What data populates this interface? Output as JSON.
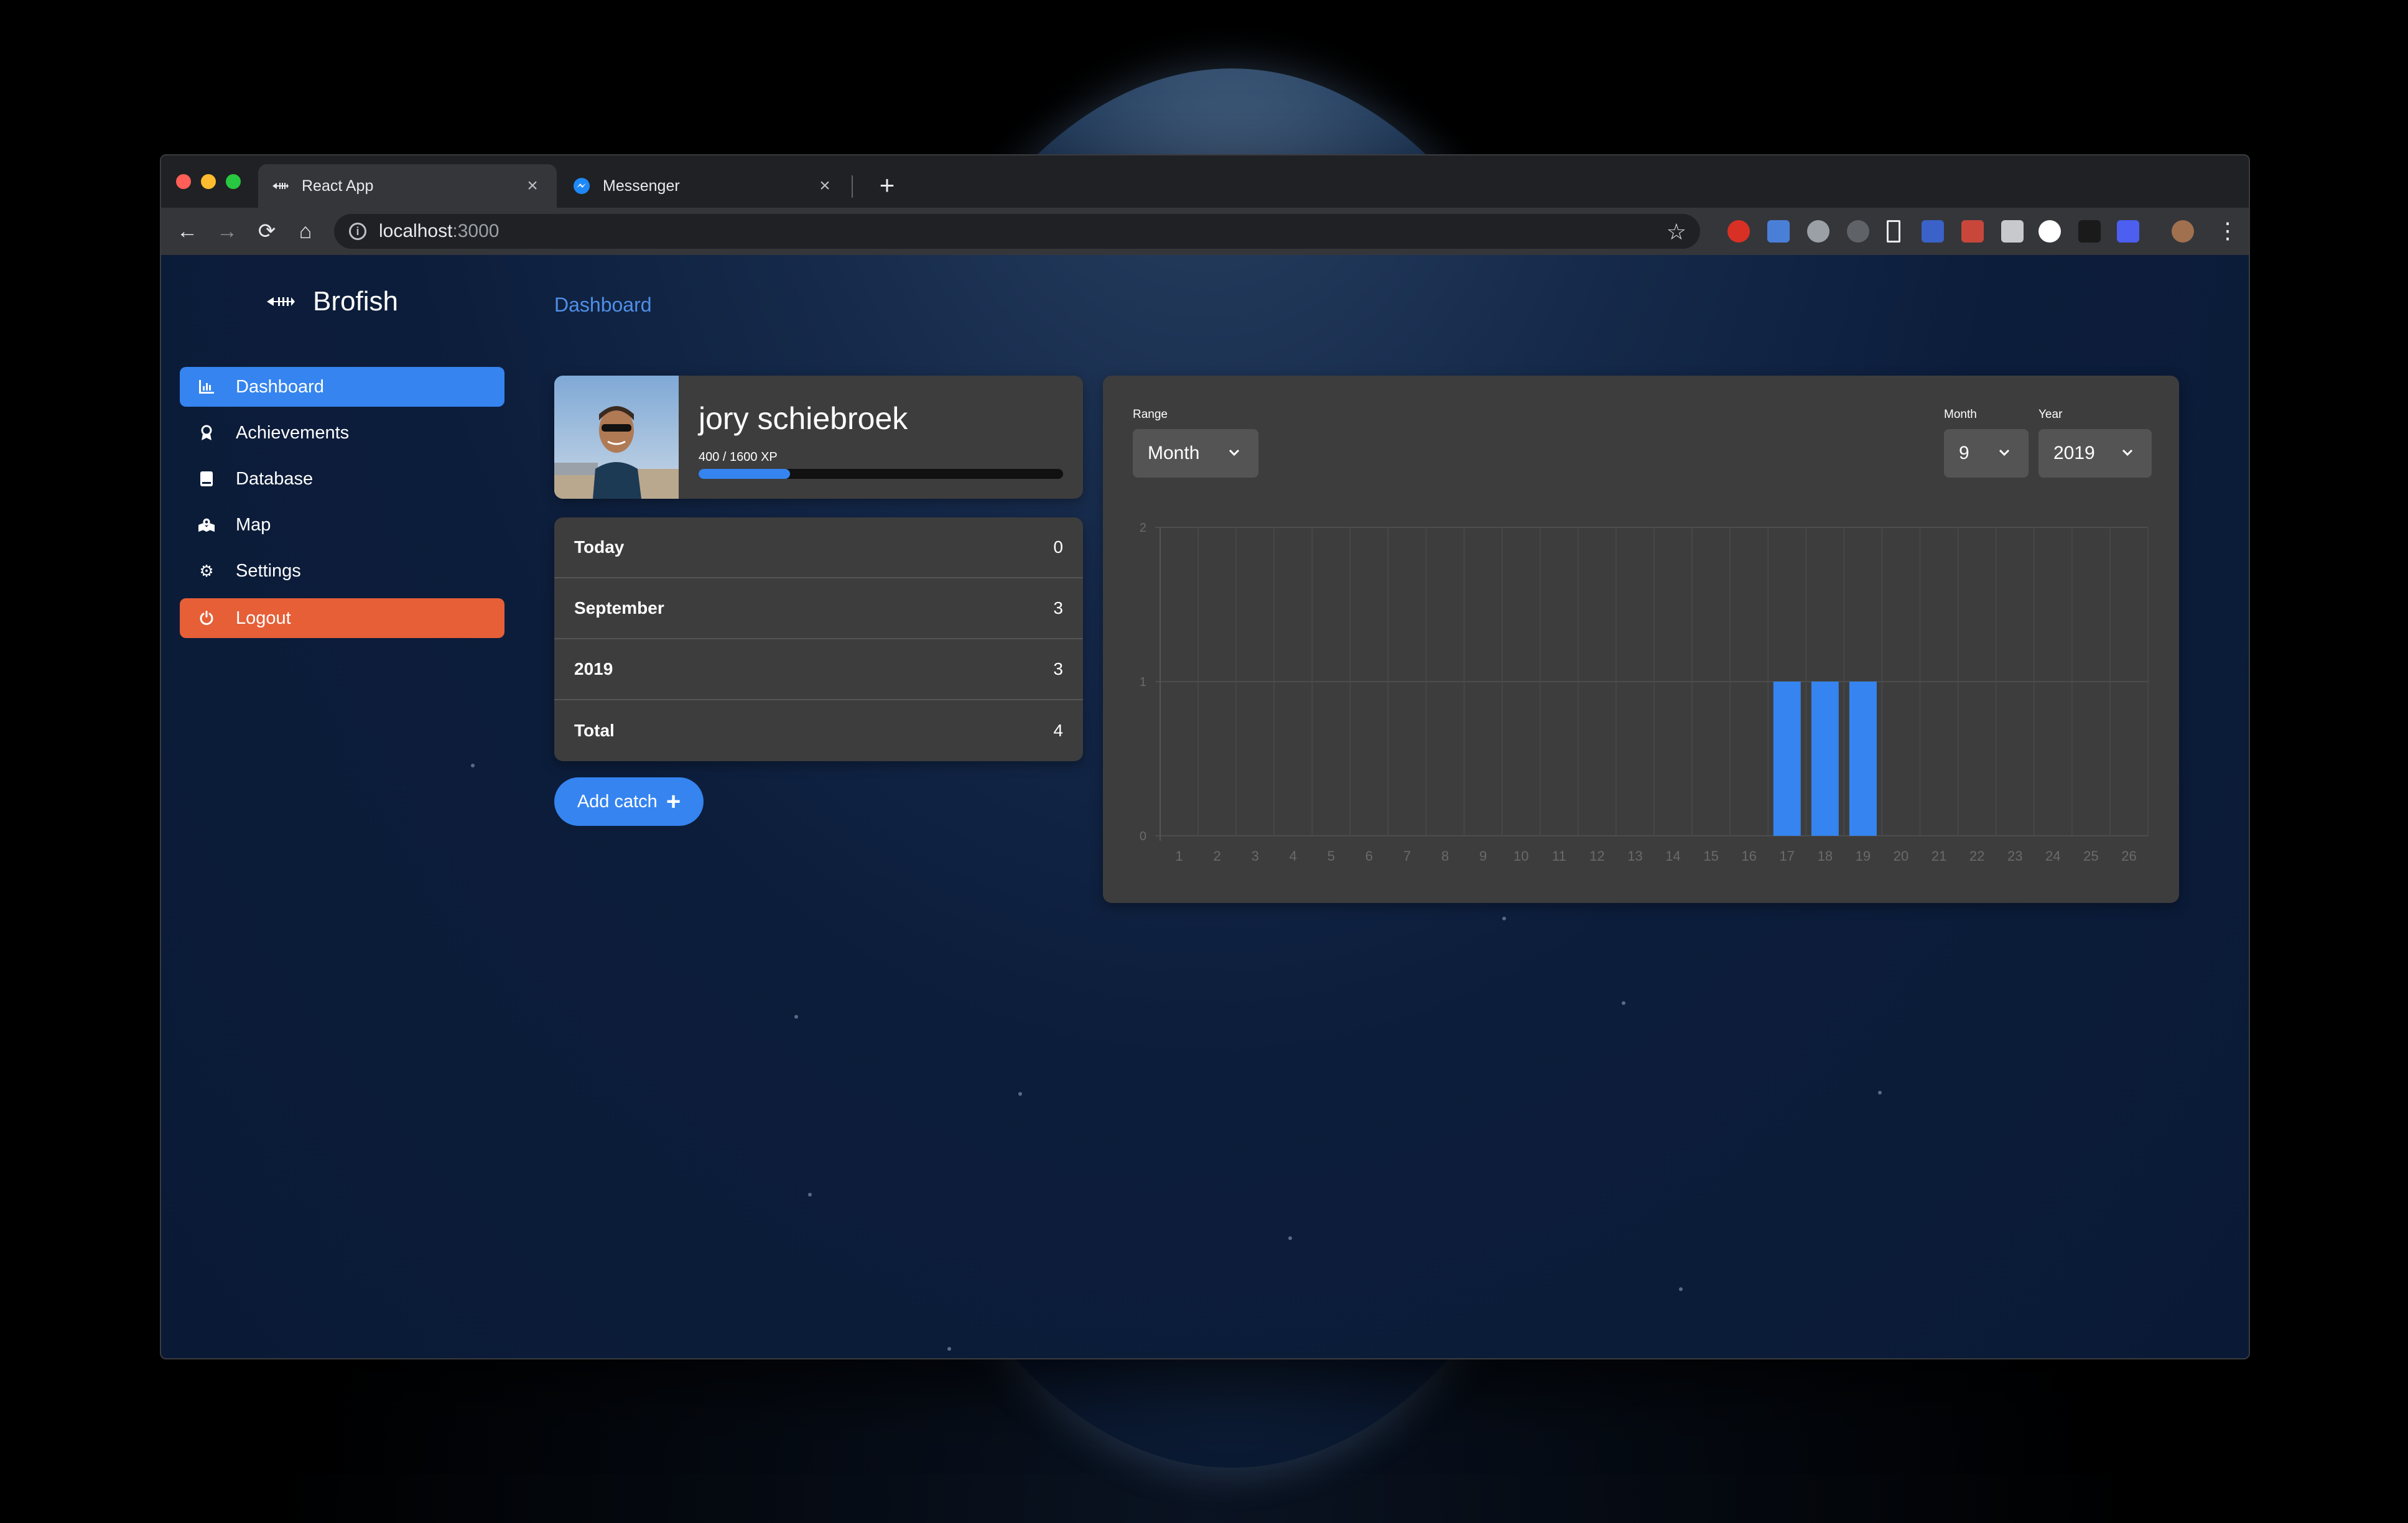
{
  "browser": {
    "tabs": [
      {
        "title": "React App",
        "active": true,
        "favicon": "fish-skeleton-icon"
      },
      {
        "title": "Messenger",
        "active": false,
        "favicon": "messenger-icon"
      }
    ],
    "url_host": "localhost",
    "url_port": ":3000",
    "colors": {
      "tab_active": "#35363a",
      "frame": "#202124"
    }
  },
  "app": {
    "brand": "Brofish",
    "breadcrumb": "Dashboard",
    "accent": "#3584f0",
    "logout_color": "#e65f37"
  },
  "sidebar": {
    "items": [
      {
        "label": "Dashboard",
        "icon": "bar-chart-icon",
        "active": true
      },
      {
        "label": "Achievements",
        "icon": "award-icon",
        "active": false
      },
      {
        "label": "Database",
        "icon": "book-icon",
        "active": false
      },
      {
        "label": "Map",
        "icon": "map-icon",
        "active": false
      },
      {
        "label": "Settings",
        "icon": "gear-icon",
        "active": false
      },
      {
        "label": "Logout",
        "icon": "power-icon",
        "active": false
      }
    ]
  },
  "profile": {
    "name": "jory schiebroek",
    "xp_text": "400 / 1600 XP",
    "xp_current": 400,
    "xp_max": 1600
  },
  "stats": [
    {
      "label": "Today",
      "value": "0"
    },
    {
      "label": "September",
      "value": "3"
    },
    {
      "label": "2019",
      "value": "3"
    },
    {
      "label": "Total",
      "value": "4"
    }
  ],
  "actions": {
    "add_catch": "Add catch"
  },
  "controls": {
    "range_label": "Range",
    "range_value": "Month",
    "month_label": "Month",
    "month_value": "9",
    "year_label": "Year",
    "year_value": "2019"
  },
  "chart_data": {
    "type": "bar",
    "title": "",
    "xlabel": "",
    "ylabel": "",
    "categories": [
      "1",
      "2",
      "3",
      "4",
      "5",
      "6",
      "7",
      "8",
      "9",
      "10",
      "11",
      "12",
      "13",
      "14",
      "15",
      "16",
      "17",
      "18",
      "19",
      "20",
      "21",
      "22",
      "23",
      "24",
      "25",
      "26"
    ],
    "values": [
      0,
      0,
      0,
      0,
      0,
      0,
      0,
      0,
      0,
      0,
      0,
      0,
      0,
      0,
      0,
      0,
      1,
      1,
      1,
      0,
      0,
      0,
      0,
      0,
      0,
      0
    ],
    "yticks": [
      "0",
      "1",
      "2"
    ],
    "ylim": [
      0,
      2
    ],
    "grid": true,
    "bar_color": "#3584f0"
  }
}
